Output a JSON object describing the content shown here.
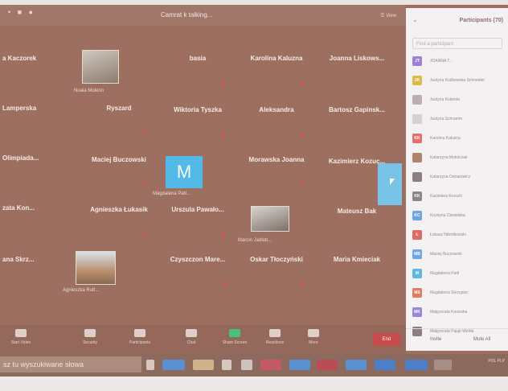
{
  "top_bar": {
    "dots": "•  ■  ●",
    "talking": "Camrat k talking...",
    "view": "☰ View"
  },
  "tiles": [
    {
      "id": "kaczorek",
      "name": "a Kaczorek"
    },
    {
      "id": "pic1",
      "name": "Nuala Molenn"
    },
    {
      "id": "basia",
      "name": "basia"
    },
    {
      "id": "kaluzna",
      "name": "Karolina Kaluzna"
    },
    {
      "id": "liskows",
      "name": "Joanna Liskows..."
    },
    {
      "id": "lamperska",
      "name": "Lamperska"
    },
    {
      "id": "ryszard",
      "name": "Ryszard"
    },
    {
      "id": "tyszka",
      "name": "Wiktoria Tyszka"
    },
    {
      "id": "aleksandra",
      "name": "Aleksandra"
    },
    {
      "id": "gapinsk",
      "name": "Bartosz Gapinsk..."
    },
    {
      "id": "olimpiada",
      "name": "Olimpiada..."
    },
    {
      "id": "buczowski",
      "name": "Maciej Buczowski"
    },
    {
      "id": "magdalena",
      "name": "Magdalena Patt..."
    },
    {
      "id": "morawska",
      "name": "Morawska Joanna"
    },
    {
      "id": "kozuch",
      "name": "Kazimierz Kozuc..."
    },
    {
      "id": "kon",
      "name": "zata Kon..."
    },
    {
      "id": "lukasik",
      "name": "Agnieszka Łukasik"
    },
    {
      "id": "pawalo",
      "name": "Urszula Pawało..."
    },
    {
      "id": "marcin",
      "name": "Marcin Jadlob..."
    },
    {
      "id": "bak",
      "name": "Mateusz Bak"
    },
    {
      "id": "skrz",
      "name": "ana Skrz..."
    },
    {
      "id": "agnieszka",
      "name": "Agnieszka Rutt..."
    },
    {
      "id": "czyszczon",
      "name": "Czyszczon Mare..."
    },
    {
      "id": "tloczynski",
      "name": "Oskar Tłoczyński"
    },
    {
      "id": "kmieciak",
      "name": "Maria Kmieciak"
    }
  ],
  "m_letter": "M",
  "toolbar": {
    "items": [
      {
        "label": "Start Video"
      },
      {
        "label": "Security"
      },
      {
        "label": "Participants"
      },
      {
        "label": "Chat"
      },
      {
        "label": "Share Screen"
      },
      {
        "label": "Reactions"
      },
      {
        "label": "More"
      }
    ],
    "end": "End"
  },
  "taskbar": {
    "search": "sz tu wyszukiwane słowa",
    "tray": "POL\nPLP"
  },
  "panel": {
    "chevron": "⌄",
    "title": "Participants (70)",
    "search_placeholder": "Find a participant",
    "participants": [
      {
        "initials": "JT",
        "name": "JOANNA T...",
        "color": "#9b82d6"
      },
      {
        "initials": "JK",
        "name": "Justyna Kuźbowska Schneider",
        "color": "#e0b84b"
      },
      {
        "initials": "",
        "name": "Justyna Kolenda",
        "color": "#bcaeb4"
      },
      {
        "initials": "",
        "name": "Justyna Schramm",
        "color": "#d9d0d3"
      },
      {
        "initials": "KK",
        "name": "Karolina Kaluzna",
        "color": "#e56e6e"
      },
      {
        "initials": "",
        "name": "Katarzyna Mutulczak",
        "color": "#b0846c"
      },
      {
        "initials": "",
        "name": "Katarzyna Ostrarowicz",
        "color": "#8f7e80"
      },
      {
        "initials": "KK",
        "name": "Kazimierz Kozuch",
        "color": "#8a8688"
      },
      {
        "initials": "KC",
        "name": "Krystyna Ciesielska",
        "color": "#73a2e0"
      },
      {
        "initials": "Ł",
        "name": "Łukasz Nitznikowski",
        "color": "#e06b62"
      },
      {
        "initials": "MB",
        "name": "Maciej Buczowski",
        "color": "#6ea7e6"
      },
      {
        "initials": "M",
        "name": "Magdalena Patti",
        "color": "#5fb8df"
      },
      {
        "initials": "MS",
        "name": "Magdalena Skrzypiec",
        "color": "#e07b62"
      },
      {
        "initials": "MK",
        "name": "Małgorzata Kosioska",
        "color": "#9b85d8"
      },
      {
        "initials": "",
        "name": "Małgorzata Pająk-Welda",
        "color": "#8f7e80"
      }
    ],
    "invite": "Invite",
    "mute_all": "Mute All"
  }
}
